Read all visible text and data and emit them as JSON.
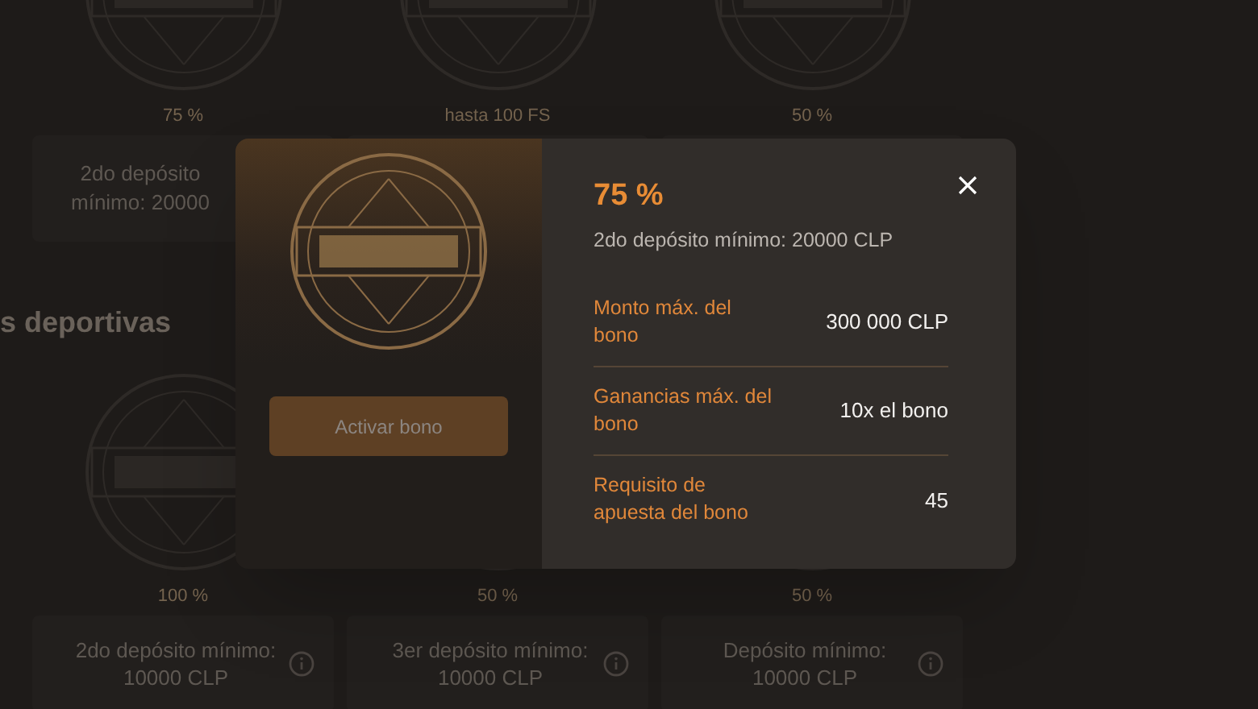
{
  "background_page": {
    "top_cards": [
      {
        "amount": "75 %",
        "description": "2do depósito mínimo: 20000"
      },
      {
        "amount": "hasta 100 FS"
      },
      {
        "amount": "50 %"
      }
    ],
    "section_title": "s deportivas",
    "bottom_cards": [
      {
        "amount": "100 %",
        "description": "2do depósito mínimo: 10000 CLP"
      },
      {
        "amount": "50 %",
        "description": "3er depósito mínimo: 10000 CLP"
      },
      {
        "amount": "50 %",
        "description": "Depósito mínimo: 10000 CLP"
      }
    ]
  },
  "modal": {
    "button": "Activar bono",
    "title": "75 %",
    "subtitle": "2do depósito mínimo: 20000 CLP",
    "details": [
      {
        "label": "Monto máx. del bono",
        "value": "300 000 CLP"
      },
      {
        "label": "Ganancias máx. del bono",
        "value": "10x el bono"
      },
      {
        "label": "Requisito de apuesta del bono",
        "value": "45"
      }
    ]
  }
}
